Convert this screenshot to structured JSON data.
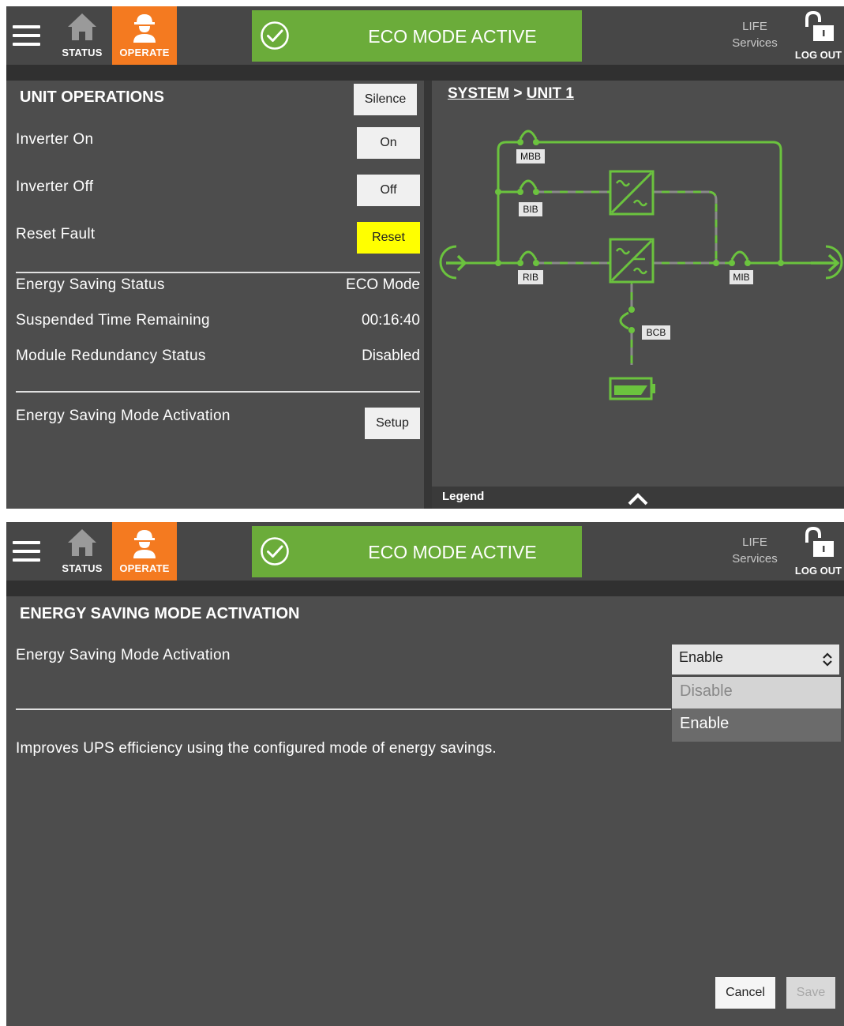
{
  "header": {
    "status_tab": "STATUS",
    "operate_tab": "OPERATE",
    "banner_text": "ECO MODE ACTIVE",
    "life_line1": "LIFE",
    "life_line2": "Services",
    "logout": "LOG OUT"
  },
  "unit_ops": {
    "title": "UNIT OPERATIONS",
    "silence_btn": "Silence",
    "rows": [
      {
        "label": "Inverter On",
        "button": "On"
      },
      {
        "label": "Inverter Off",
        "button": "Off"
      },
      {
        "label": "Reset Fault",
        "button": "Reset"
      }
    ],
    "status_rows": [
      {
        "label": "Energy Saving Status",
        "value": "ECO Mode"
      },
      {
        "label": "Suspended Time Remaining",
        "value": "00:16:40"
      },
      {
        "label": "Module Redundancy Status",
        "value": "Disabled"
      }
    ],
    "activation_label": "Energy Saving Mode Activation",
    "setup_btn": "Setup"
  },
  "diagram": {
    "breadcrumb_system": "SYSTEM",
    "breadcrumb_sep": ">",
    "breadcrumb_unit": "UNIT 1",
    "labels": {
      "mbb": "MBB",
      "bib": "BIB",
      "rib": "RIB",
      "mib": "MIB",
      "bcb": "BCB"
    },
    "legend": "Legend",
    "colors": {
      "active": "#6bc33e",
      "dashed": "#8a8a8a"
    }
  },
  "activation_page": {
    "title": "ENERGY SAVING MODE ACTIVATION",
    "field_label": "Energy Saving Mode Activation",
    "selected": "Enable",
    "options": [
      "Disable",
      "Enable"
    ],
    "description": "Improves UPS efficiency using the configured mode of energy savings.",
    "cancel": "Cancel",
    "save": "Save"
  },
  "colors": {
    "accent": "#f47a20",
    "banner": "#6bac3a",
    "reset_button": "#ffff00"
  },
  "icons": [
    "menu-icon",
    "home-icon",
    "worker-icon",
    "check-circle-icon",
    "unlock-icon",
    "chevron-up-icon",
    "sort-arrows-icon"
  ]
}
